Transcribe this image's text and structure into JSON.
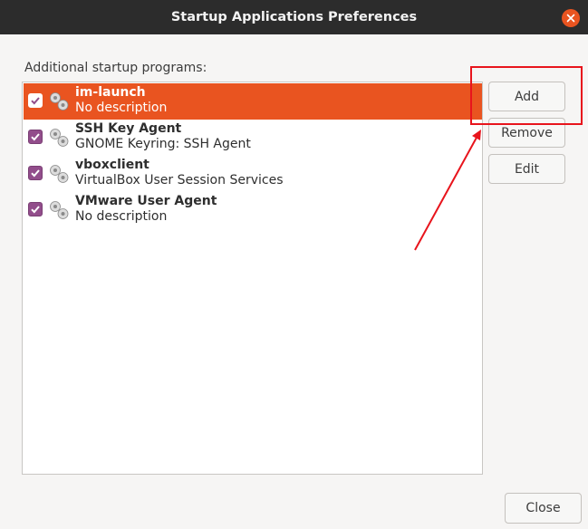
{
  "window": {
    "title": "Startup Applications Preferences"
  },
  "list": {
    "label": "Additional startup programs:",
    "items": [
      {
        "name": "im-launch",
        "description": "No description",
        "checked": true,
        "selected": true
      },
      {
        "name": "SSH Key Agent",
        "description": "GNOME Keyring: SSH Agent",
        "checked": true,
        "selected": false
      },
      {
        "name": "vboxclient",
        "description": "VirtualBox User Session Services",
        "checked": true,
        "selected": false
      },
      {
        "name": "VMware User Agent",
        "description": "No description",
        "checked": true,
        "selected": false
      }
    ]
  },
  "buttons": {
    "add": "Add",
    "remove": "Remove",
    "edit": "Edit",
    "close": "Close"
  },
  "colors": {
    "accent": "#e95420",
    "checkbox": "#924d8b",
    "annotation": "#e8141c"
  }
}
